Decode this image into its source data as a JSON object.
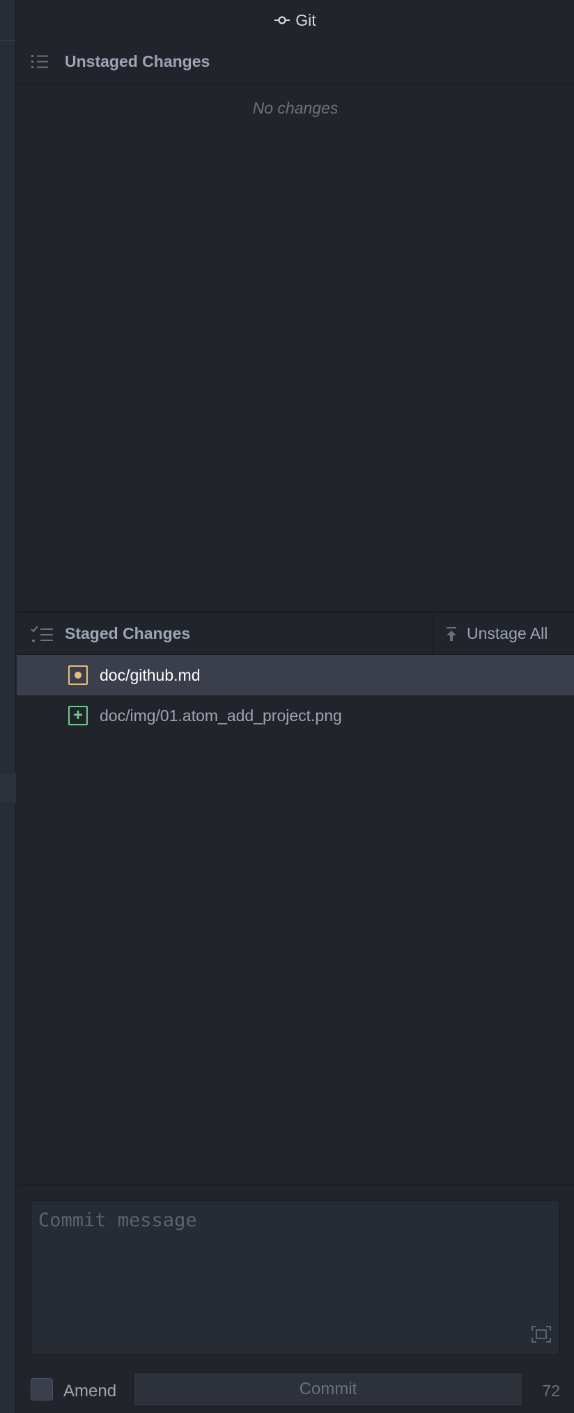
{
  "window": {
    "title": "Git"
  },
  "unstaged": {
    "title": "Unstaged Changes",
    "empty_text": "No changes"
  },
  "staged": {
    "title": "Staged Changes",
    "unstage_all_label": "Unstage All",
    "files": [
      {
        "name": "doc/github.md",
        "status": "modified",
        "selected": true
      },
      {
        "name": "doc/img/01.atom_add_project.png",
        "status": "added",
        "selected": false
      }
    ]
  },
  "commit": {
    "message_value": "",
    "message_placeholder": "Commit message",
    "amend_label": "Amend",
    "amend_checked": false,
    "button_label": "Commit",
    "remaining_chars": "72"
  },
  "colors": {
    "background": "#21242b",
    "selected_row": "#3a3f4b",
    "modified": "#e5c07b",
    "added": "#73c990"
  },
  "icons": {
    "title": "git-commit-icon",
    "unstaged": "list-unordered-icon",
    "staged": "tasklist-icon",
    "unstage_all": "move-up-icon",
    "expand": "screen-full-icon"
  }
}
